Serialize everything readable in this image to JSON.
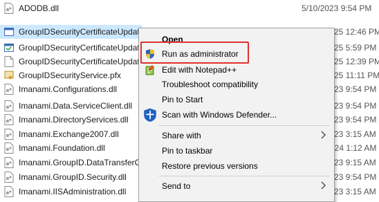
{
  "files": [
    {
      "name": "ADODB.dll",
      "date": "5/10/2023 9:54 PM",
      "icon": "dll-file-icon"
    },
    {
      "name": "GroupIDSecurityCertificateUpdat",
      "date": "25 12:46 PM",
      "icon": "exe-file-icon",
      "selected": true
    },
    {
      "name": "GroupIDSecurityCertificateUpdat",
      "date": "25 5:59 PM",
      "icon": "exe-file-icon"
    },
    {
      "name": "GroupIDSecurityCertificateUpdat",
      "date": "25 12:39 PM",
      "icon": "blank-file-icon"
    },
    {
      "name": "GroupIDSecurityService.pfx",
      "date": "25 11:11 PM",
      "icon": "certificate-file-icon"
    },
    {
      "name": "Imanami.Configurations.dll",
      "date": "23 9:54 PM",
      "icon": "dll-file-icon"
    },
    {
      "name": "Imanami.Data.ServiceClient.dll",
      "date": "23 9:54 PM",
      "icon": "dll-file-icon"
    },
    {
      "name": "Imanami.DirectoryServices.dll",
      "date": "23 9:54 PM",
      "icon": "dll-file-icon"
    },
    {
      "name": "Imanami.Exchange2007.dll",
      "date": "23 3:15 AM",
      "icon": "dll-file-icon"
    },
    {
      "name": "Imanami.Foundation.dll",
      "date": "024 1:12 AM",
      "icon": "dll-file-icon"
    },
    {
      "name": "Imanami.GroupID.DataTransferO",
      "date": "23 9:15 AM",
      "icon": "dll-file-icon"
    },
    {
      "name": "Imanami.GroupID.Security.dll",
      "date": "23 9:54 PM",
      "icon": "dll-file-icon"
    },
    {
      "name": "Imanami.IISAdministration.dll",
      "date": "23 3:15 AM",
      "icon": "dll-file-icon"
    }
  ],
  "menu": {
    "open": "Open",
    "run_as_admin": "Run as administrator",
    "edit_notepad": "Edit with Notepad++",
    "troubleshoot": "Troubleshoot compatibility",
    "pin_start": "Pin to Start",
    "scan_defender": "Scan with Windows Defender...",
    "share_with": "Share with",
    "pin_taskbar": "Pin to taskbar",
    "restore_versions": "Restore previous versions",
    "send_to": "Send to"
  },
  "colors": {
    "selection": "#cce8ff",
    "highlight_border": "#e0302c",
    "menu_bg": "#f2f2f2"
  }
}
